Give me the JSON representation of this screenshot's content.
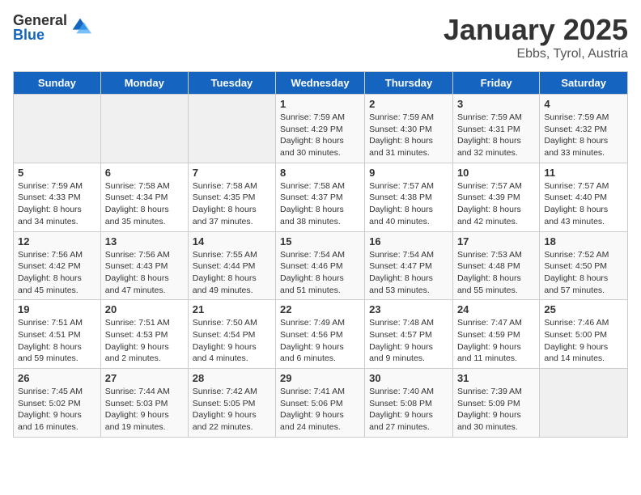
{
  "logo": {
    "general": "General",
    "blue": "Blue"
  },
  "header": {
    "month": "January 2025",
    "location": "Ebbs, Tyrol, Austria"
  },
  "weekdays": [
    "Sunday",
    "Monday",
    "Tuesday",
    "Wednesday",
    "Thursday",
    "Friday",
    "Saturday"
  ],
  "weeks": [
    [
      {
        "day": "",
        "info": ""
      },
      {
        "day": "",
        "info": ""
      },
      {
        "day": "",
        "info": ""
      },
      {
        "day": "1",
        "info": "Sunrise: 7:59 AM\nSunset: 4:29 PM\nDaylight: 8 hours\nand 30 minutes."
      },
      {
        "day": "2",
        "info": "Sunrise: 7:59 AM\nSunset: 4:30 PM\nDaylight: 8 hours\nand 31 minutes."
      },
      {
        "day": "3",
        "info": "Sunrise: 7:59 AM\nSunset: 4:31 PM\nDaylight: 8 hours\nand 32 minutes."
      },
      {
        "day": "4",
        "info": "Sunrise: 7:59 AM\nSunset: 4:32 PM\nDaylight: 8 hours\nand 33 minutes."
      }
    ],
    [
      {
        "day": "5",
        "info": "Sunrise: 7:59 AM\nSunset: 4:33 PM\nDaylight: 8 hours\nand 34 minutes."
      },
      {
        "day": "6",
        "info": "Sunrise: 7:58 AM\nSunset: 4:34 PM\nDaylight: 8 hours\nand 35 minutes."
      },
      {
        "day": "7",
        "info": "Sunrise: 7:58 AM\nSunset: 4:35 PM\nDaylight: 8 hours\nand 37 minutes."
      },
      {
        "day": "8",
        "info": "Sunrise: 7:58 AM\nSunset: 4:37 PM\nDaylight: 8 hours\nand 38 minutes."
      },
      {
        "day": "9",
        "info": "Sunrise: 7:57 AM\nSunset: 4:38 PM\nDaylight: 8 hours\nand 40 minutes."
      },
      {
        "day": "10",
        "info": "Sunrise: 7:57 AM\nSunset: 4:39 PM\nDaylight: 8 hours\nand 42 minutes."
      },
      {
        "day": "11",
        "info": "Sunrise: 7:57 AM\nSunset: 4:40 PM\nDaylight: 8 hours\nand 43 minutes."
      }
    ],
    [
      {
        "day": "12",
        "info": "Sunrise: 7:56 AM\nSunset: 4:42 PM\nDaylight: 8 hours\nand 45 minutes."
      },
      {
        "day": "13",
        "info": "Sunrise: 7:56 AM\nSunset: 4:43 PM\nDaylight: 8 hours\nand 47 minutes."
      },
      {
        "day": "14",
        "info": "Sunrise: 7:55 AM\nSunset: 4:44 PM\nDaylight: 8 hours\nand 49 minutes."
      },
      {
        "day": "15",
        "info": "Sunrise: 7:54 AM\nSunset: 4:46 PM\nDaylight: 8 hours\nand 51 minutes."
      },
      {
        "day": "16",
        "info": "Sunrise: 7:54 AM\nSunset: 4:47 PM\nDaylight: 8 hours\nand 53 minutes."
      },
      {
        "day": "17",
        "info": "Sunrise: 7:53 AM\nSunset: 4:48 PM\nDaylight: 8 hours\nand 55 minutes."
      },
      {
        "day": "18",
        "info": "Sunrise: 7:52 AM\nSunset: 4:50 PM\nDaylight: 8 hours\nand 57 minutes."
      }
    ],
    [
      {
        "day": "19",
        "info": "Sunrise: 7:51 AM\nSunset: 4:51 PM\nDaylight: 8 hours\nand 59 minutes."
      },
      {
        "day": "20",
        "info": "Sunrise: 7:51 AM\nSunset: 4:53 PM\nDaylight: 9 hours\nand 2 minutes."
      },
      {
        "day": "21",
        "info": "Sunrise: 7:50 AM\nSunset: 4:54 PM\nDaylight: 9 hours\nand 4 minutes."
      },
      {
        "day": "22",
        "info": "Sunrise: 7:49 AM\nSunset: 4:56 PM\nDaylight: 9 hours\nand 6 minutes."
      },
      {
        "day": "23",
        "info": "Sunrise: 7:48 AM\nSunset: 4:57 PM\nDaylight: 9 hours\nand 9 minutes."
      },
      {
        "day": "24",
        "info": "Sunrise: 7:47 AM\nSunset: 4:59 PM\nDaylight: 9 hours\nand 11 minutes."
      },
      {
        "day": "25",
        "info": "Sunrise: 7:46 AM\nSunset: 5:00 PM\nDaylight: 9 hours\nand 14 minutes."
      }
    ],
    [
      {
        "day": "26",
        "info": "Sunrise: 7:45 AM\nSunset: 5:02 PM\nDaylight: 9 hours\nand 16 minutes."
      },
      {
        "day": "27",
        "info": "Sunrise: 7:44 AM\nSunset: 5:03 PM\nDaylight: 9 hours\nand 19 minutes."
      },
      {
        "day": "28",
        "info": "Sunrise: 7:42 AM\nSunset: 5:05 PM\nDaylight: 9 hours\nand 22 minutes."
      },
      {
        "day": "29",
        "info": "Sunrise: 7:41 AM\nSunset: 5:06 PM\nDaylight: 9 hours\nand 24 minutes."
      },
      {
        "day": "30",
        "info": "Sunrise: 7:40 AM\nSunset: 5:08 PM\nDaylight: 9 hours\nand 27 minutes."
      },
      {
        "day": "31",
        "info": "Sunrise: 7:39 AM\nSunset: 5:09 PM\nDaylight: 9 hours\nand 30 minutes."
      },
      {
        "day": "",
        "info": ""
      }
    ]
  ]
}
